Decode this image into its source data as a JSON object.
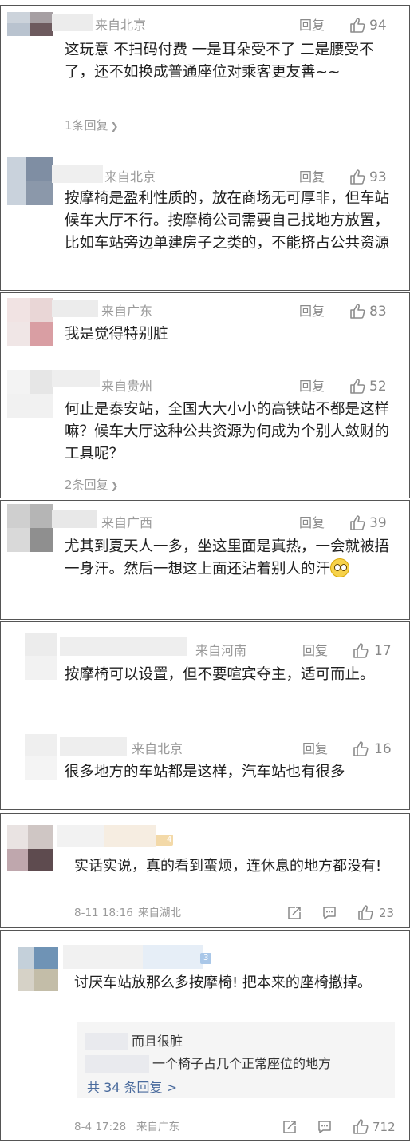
{
  "thumb_color": "#888888",
  "comments": [
    {
      "source": "来自北京",
      "reply_label": "回复",
      "likes": "94",
      "text": "这玩意 不扫码付费 一是耳朵受不了 二是腰受不了，还不如换成普通座位对乘客更友善~~",
      "replies": "1条回复"
    },
    {
      "source": "来自北京",
      "reply_label": "回复",
      "likes": "93",
      "text": "按摩椅是盈利性质的，放在商场无可厚非，但车站候车大厅不行。按摩椅公司需要自己找地方放置，比如车站旁边单建房子之类的，不能挤占公共资源"
    },
    {
      "source": "来自广东",
      "reply_label": "回复",
      "likes": "83",
      "text": "我是觉得特别脏"
    },
    {
      "source": "来自贵州",
      "reply_label": "回复",
      "likes": "52",
      "text": "何止是泰安站，全国大大小小的高铁站不都是这样嘛？候车大厅这种公共资源为何成为个别人敛财的工具呢？",
      "replies": "2条回复"
    },
    {
      "source": "来自广西",
      "reply_label": "回复",
      "likes": "39",
      "text": "尤其到夏天人一多，坐这里面是真热，一会就被捂一身汗。然后一想这上面还沾着别人的汗",
      "emoji": "flushed-emoji"
    },
    {
      "source": "来自河南",
      "reply_label": "回复",
      "likes": "17",
      "text": "按摩椅可以设置，但不要喧宾夺主，适可而止。"
    },
    {
      "source": "来自北京",
      "reply_label": "回复",
      "likes": "16",
      "text": "很多地方的车站都是这样，汽车站也有很多"
    },
    {
      "badge": "4",
      "text": "实话实说，真的看到蛮烦，连休息的地方都没有!",
      "time": "8-11 18:16",
      "source": "来自湖北",
      "likes": "23"
    },
    {
      "badge": "3",
      "text": "讨厌车站放那么多按摩椅! 把本来的座椅撤掉。",
      "sub_replies": [
        "而且很脏",
        "一个椅子占几个正常座位的地方"
      ],
      "more_replies": "共 34 条回复 >",
      "time": "8-4 17:28",
      "source": "来自广东",
      "likes": "712"
    }
  ]
}
